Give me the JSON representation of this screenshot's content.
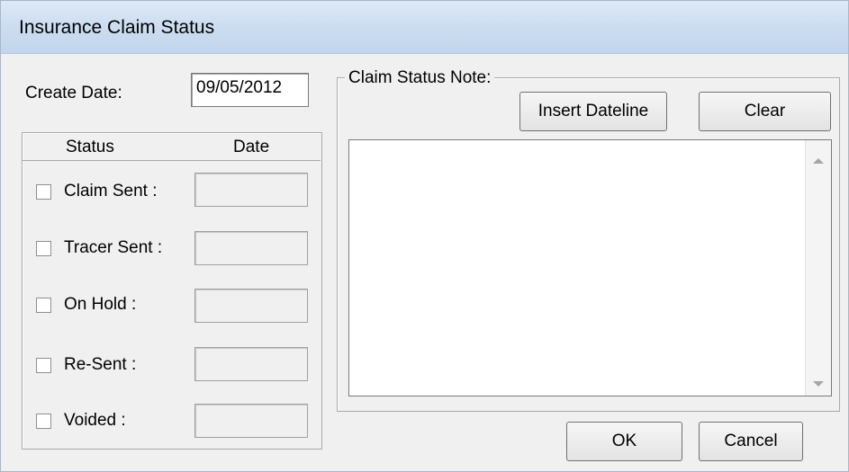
{
  "window": {
    "title": "Insurance Claim Status"
  },
  "create_date": {
    "label": "Create Date:",
    "value": "09/05/2012"
  },
  "status_group": {
    "col_status": "Status",
    "col_date": "Date",
    "items": [
      {
        "label": "Claim Sent :",
        "checked": false,
        "date": ""
      },
      {
        "label": "Tracer Sent :",
        "checked": false,
        "date": ""
      },
      {
        "label": "On Hold :",
        "checked": false,
        "date": ""
      },
      {
        "label": "Re-Sent :",
        "checked": false,
        "date": ""
      },
      {
        "label": "Voided :",
        "checked": false,
        "date": ""
      }
    ]
  },
  "note_group": {
    "label": "Claim Status Note:",
    "insert_label": "Insert Dateline",
    "clear_label": "Clear",
    "text": ""
  },
  "buttons": {
    "ok_label": "OK",
    "cancel_label": "Cancel"
  }
}
